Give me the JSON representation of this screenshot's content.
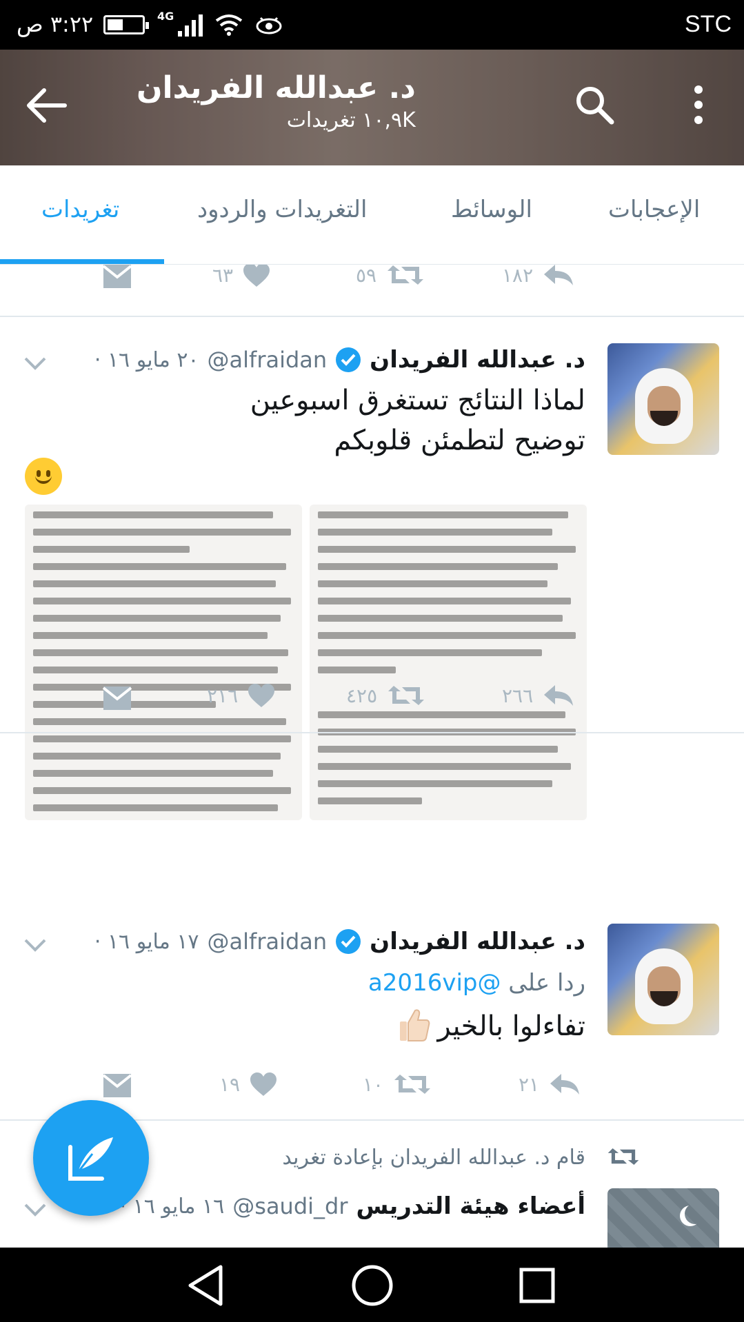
{
  "status_bar": {
    "carrier": "STC",
    "time": "٣:٢٢ ص",
    "network_label": "4G"
  },
  "header": {
    "name": "د. عبدالله الفريدان",
    "tweet_count": "١٠,٩K تغريدات"
  },
  "tabs": [
    {
      "label": "تغريدات",
      "active": true
    },
    {
      "label": "التغريدات والردود",
      "active": false
    },
    {
      "label": "الوسائط",
      "active": false
    },
    {
      "label": "الإعجابات",
      "active": false
    }
  ],
  "prev_tweet_actions": {
    "replies": "١٨٢",
    "retweets": "٥٩",
    "likes": "٦٣"
  },
  "tweets": [
    {
      "name": "د. عبدالله الفريدان",
      "handle": "@alfraidan",
      "date": "٢٠ مايو ١٦ ·",
      "text_lines": [
        "لماذا النتائج تستغرق اسبوعين",
        "توضيح لتطمئن قلوبكم"
      ],
      "emoji": "slightly-smiling-face",
      "actions": {
        "replies": "٢٦٦",
        "retweets": "٤٢٥",
        "likes": "٢١٦"
      }
    },
    {
      "name": "د. عبدالله الفريدان",
      "handle": "@alfraidan",
      "date": "١٧ مايو ١٦ ·",
      "reply_prefix": "ردا على",
      "reply_to": "@a2016vip",
      "text": "تفاءلوا بالخير",
      "emoji": "thumbs-up",
      "actions": {
        "replies": "٢١",
        "retweets": "١٠",
        "likes": "١٩"
      }
    },
    {
      "retweet_context": "قام د. عبدالله الفريدان بإعادة تغريد",
      "name": "أعضاء هيئة التدريس",
      "handle": "@saudi_dr",
      "date": "١٦ مايو ١٦ ·"
    }
  ],
  "colors": {
    "accent": "#1da1f2",
    "action_gray": "#aab8c2",
    "text_primary": "#14171a",
    "text_secondary": "#657786"
  },
  "icons": {
    "back": "arrow-left-icon",
    "search": "search-icon",
    "more": "more-vertical-icon",
    "compose": "compose-feather-icon",
    "reply": "reply-icon",
    "retweet": "retweet-icon",
    "like": "heart-icon",
    "dm": "envelope-icon",
    "verified": "verified-badge-icon",
    "caret": "chevron-down-icon"
  }
}
